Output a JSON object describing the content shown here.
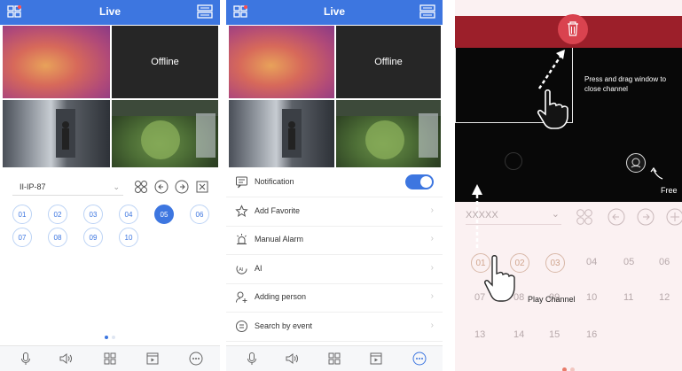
{
  "panel1": {
    "title": "Live",
    "video_offline_text": "Offline",
    "device_name": "II-IP-87",
    "channels": [
      "01",
      "02",
      "03",
      "04",
      "05",
      "06",
      "07",
      "08",
      "09",
      "10"
    ],
    "active_channel": "05",
    "page_dots": 2,
    "active_dot": 0,
    "toolbar": [
      "mic-icon",
      "speaker-icon",
      "grid-icon",
      "playback-icon",
      "more-icon"
    ]
  },
  "panel2": {
    "title": "Live",
    "video_offline_text": "Offline",
    "menu": [
      {
        "label": "Notification",
        "icon": "notification-icon",
        "toggle": true
      },
      {
        "label": "Add Favorite",
        "icon": "star-icon"
      },
      {
        "label": "Manual Alarm",
        "icon": "alarm-icon"
      },
      {
        "label": "AI",
        "icon": "ai-icon"
      },
      {
        "label": "Adding person",
        "icon": "person-add-icon"
      },
      {
        "label": "Search by event",
        "icon": "search-event-icon"
      }
    ],
    "toolbar": [
      "mic-icon",
      "speaker-icon",
      "grid-icon",
      "playback-icon",
      "more-icon"
    ]
  },
  "panel3": {
    "drag_hint": "Press and drag window to close channel",
    "free_label": "Free",
    "device_name": "XXXXX",
    "play_channel_label": "Play Channel",
    "channels": [
      "01",
      "02",
      "03",
      "04",
      "05",
      "06",
      "07",
      "08",
      "09",
      "10",
      "11",
      "12",
      "13",
      "14",
      "15",
      "16"
    ]
  },
  "colors": {
    "accent": "#3d76e0",
    "delete": "#d9434f",
    "offline_bg": "#262626"
  }
}
